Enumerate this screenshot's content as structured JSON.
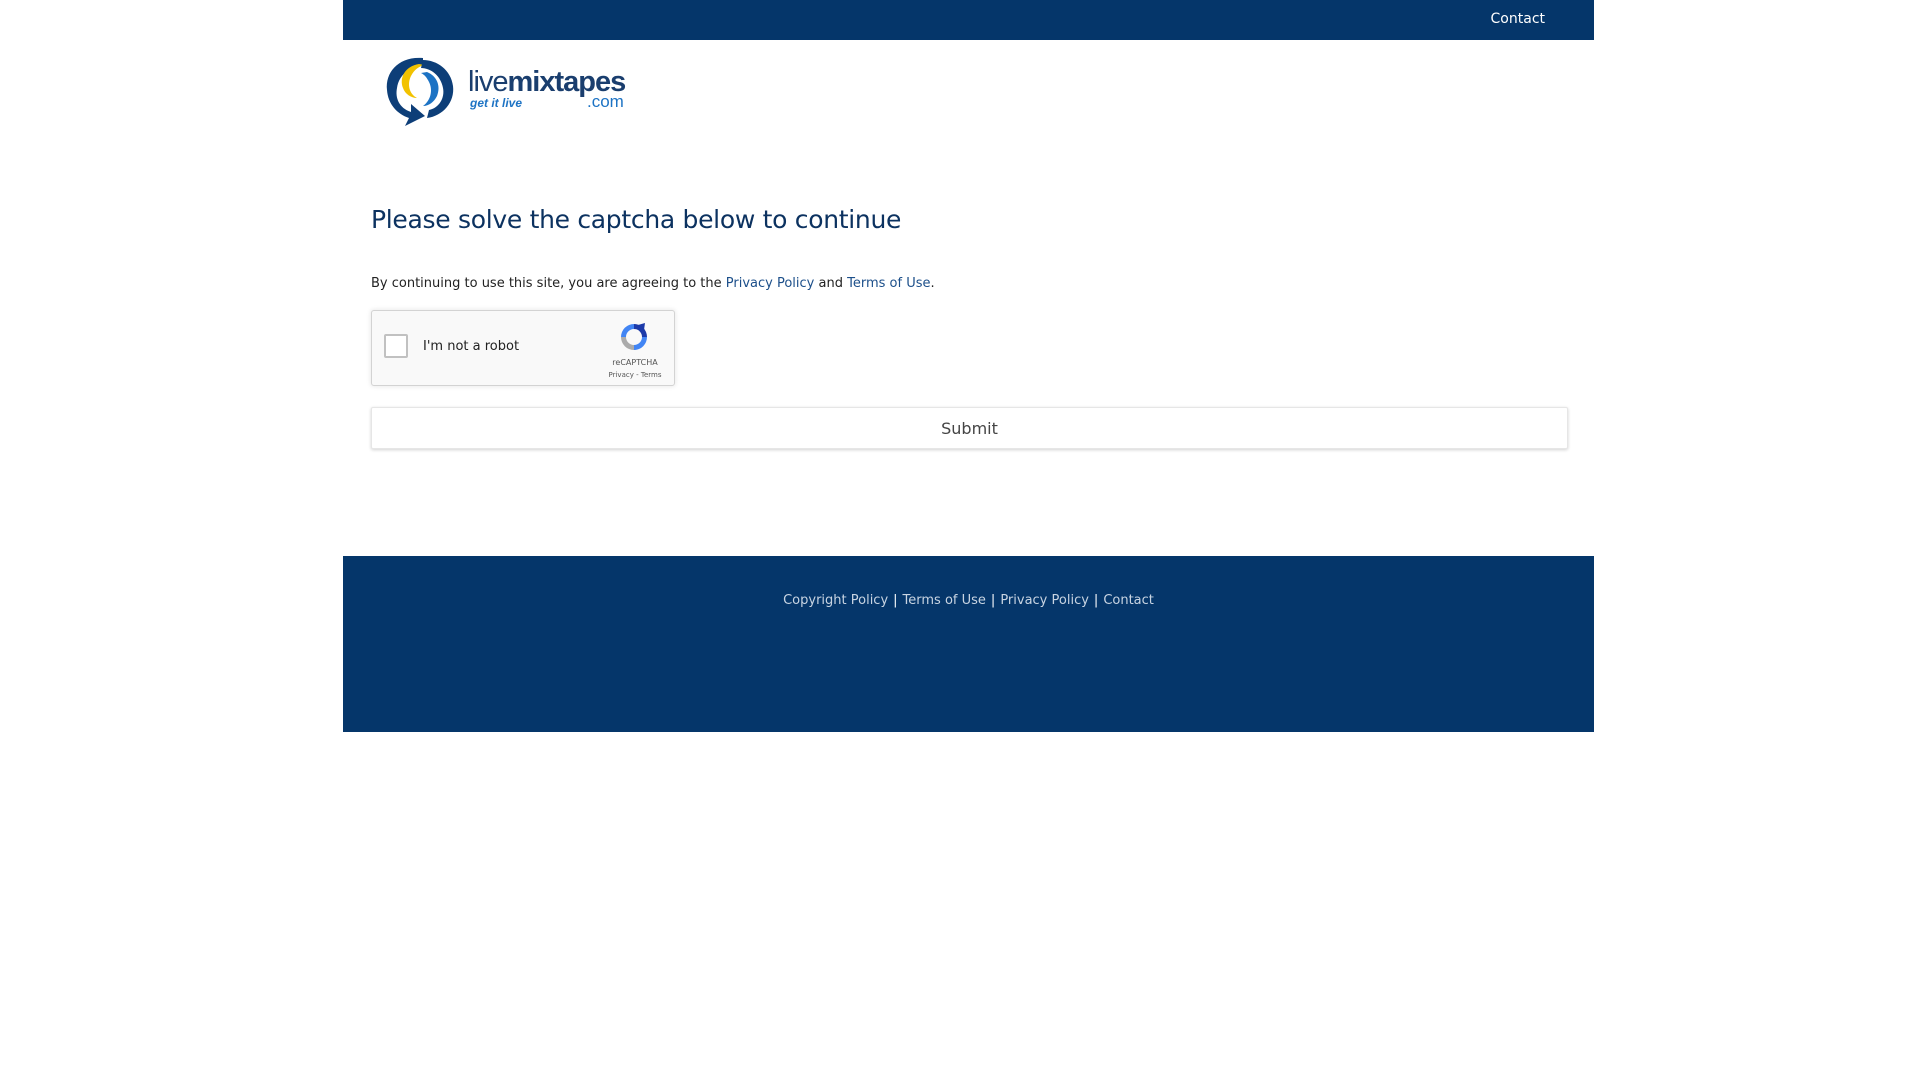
{
  "header": {
    "contact_label": "Contact"
  },
  "logo": {
    "brand_light": "live",
    "brand_bold": "mixtapes",
    "tagline": "get it live",
    "dotcom": ".com",
    "icon": "livemixtapes-swirl-logo-icon"
  },
  "main": {
    "heading": "Please solve the captcha below to continue",
    "notice_prefix": "By continuing to use this site, you are agreeing to the",
    "privacy_link": "Privacy Policy",
    "notice_and": "and",
    "terms_link": "Terms of Use",
    "notice_suffix": "."
  },
  "captcha": {
    "label": "I'm not a robot",
    "brand": "reCAPTCHA",
    "privacy": "Privacy",
    "separator": " - ",
    "terms": "Terms",
    "icon": "recaptcha-icon"
  },
  "submit_label": "Submit",
  "footer": {
    "links": [
      "Copyright Policy",
      "Terms of Use",
      "Privacy Policy",
      "Contact"
    ],
    "separator": "|"
  },
  "colors": {
    "navy": "#05366a",
    "link": "#1c4f8a",
    "logo_yellow": "#f2c200",
    "logo_blue": "#1d73c4"
  }
}
